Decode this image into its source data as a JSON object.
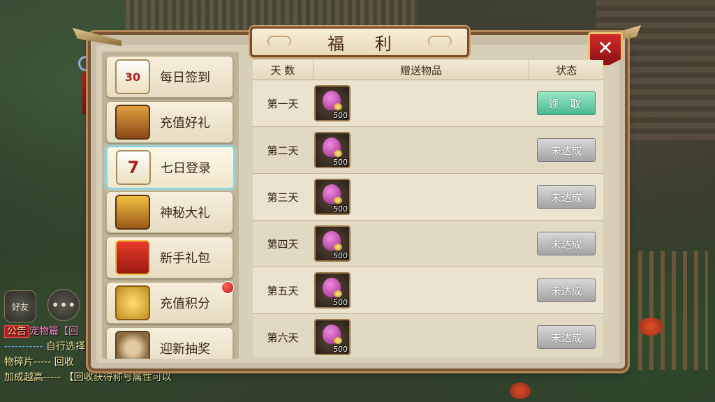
{
  "panel": {
    "title": "福 利",
    "close_icon": "close-icon"
  },
  "sidebar": {
    "items": [
      {
        "label": "每日签到",
        "icon": "calendar-30-icon",
        "icon_text": "30"
      },
      {
        "label": "充值好礼",
        "icon": "treasure-chest-icon"
      },
      {
        "label": "七日登录",
        "icon": "calendar-7-icon",
        "icon_text": "7",
        "active": true
      },
      {
        "label": "神秘大礼",
        "icon": "gold-chest-icon"
      },
      {
        "label": "新手礼包",
        "icon": "gift-box-icon"
      },
      {
        "label": "充值积分",
        "icon": "gold-coins-icon",
        "badge": true
      },
      {
        "label": "迎新抽奖",
        "icon": "lottery-wheel-icon"
      }
    ]
  },
  "table": {
    "headers": {
      "day": "天 数",
      "item": "赠送物品",
      "status": "状态"
    },
    "rows": [
      {
        "day": "第一天",
        "qty": "500",
        "status": "领 取",
        "claimable": true
      },
      {
        "day": "第二天",
        "qty": "500",
        "status": "未达成",
        "claimable": false
      },
      {
        "day": "第三天",
        "qty": "500",
        "status": "未达成",
        "claimable": false
      },
      {
        "day": "第四天",
        "qty": "500",
        "status": "未达成",
        "claimable": false
      },
      {
        "day": "第五天",
        "qty": "500",
        "status": "未达成",
        "claimable": false
      },
      {
        "day": "第六天",
        "qty": "500",
        "status": "未达成",
        "claimable": false
      }
    ]
  },
  "hud": {
    "friends_label": "好友",
    "chat_icon": "chat-bubble-icon"
  },
  "chat": {
    "tag": "公告",
    "line1_pet": "宠物篇【回",
    "line2_dash": "-----------",
    "line2_text": "自行选择",
    "line3": "物碎片----- 回收",
    "line4": "加成越高----- 【回收获得称号属性可以"
  },
  "colors": {
    "claim_button": "#4ab890",
    "locked_button": "#a4a4a4",
    "close_button": "#c01e1e",
    "active_tab_glow": "#7fd8e8"
  }
}
